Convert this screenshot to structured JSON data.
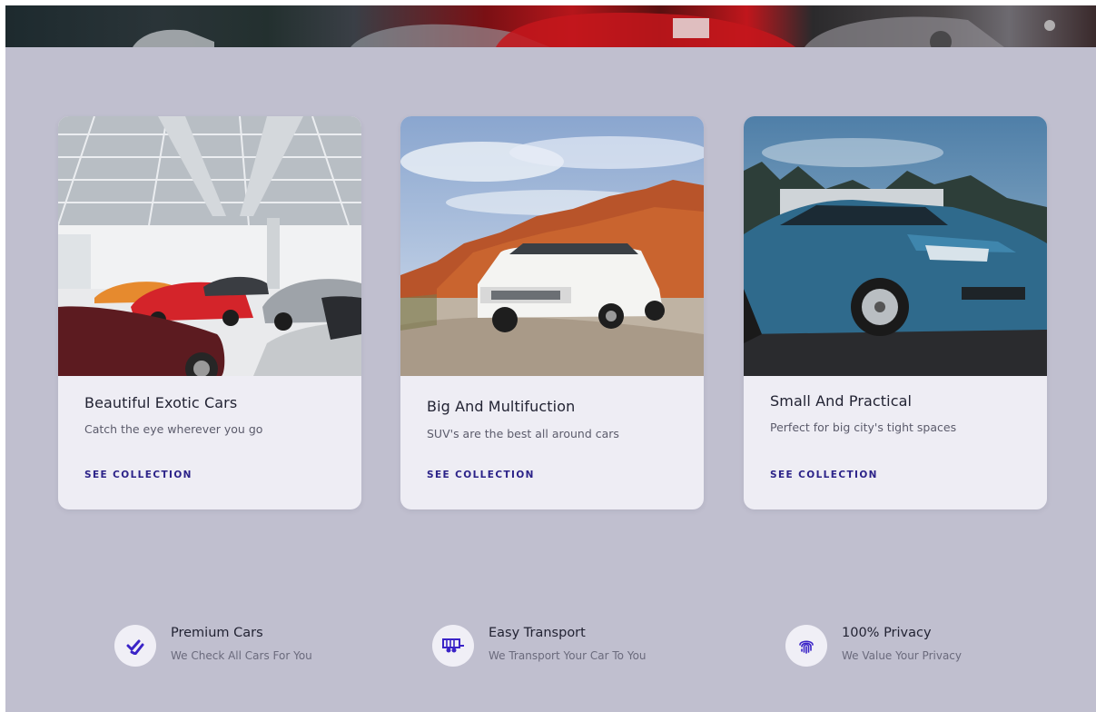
{
  "colors": {
    "background": "#c0bfcf",
    "card": "#eeedf4",
    "accent": "#2b2288",
    "text": "#222333",
    "muted": "#5b5b6b"
  },
  "cards": [
    {
      "title": "Beautiful Exotic Cars",
      "description": "Catch the eye wherever you go",
      "link": "SEE COLLECTION",
      "image": "showroom-exotic-cars-photo"
    },
    {
      "title": "Big And Multifuction",
      "description": "SUV's are the best all around cars",
      "link": "SEE COLLECTION",
      "image": "white-suv-desert-photo"
    },
    {
      "title": "Small And Practical",
      "description": "Perfect for big city's tight spaces",
      "link": "SEE COLLECTION",
      "image": "blue-hatchback-photo"
    }
  ],
  "features": [
    {
      "title": "Premium Cars",
      "description": "We Check All Cars For You",
      "icon": "double-check-icon"
    },
    {
      "title": "Easy Transport",
      "description": "We Transport Your Car To You",
      "icon": "trailer-icon"
    },
    {
      "title": "100% Privacy",
      "description": "We Value Your Privacy",
      "icon": "fingerprint-icon"
    }
  ]
}
